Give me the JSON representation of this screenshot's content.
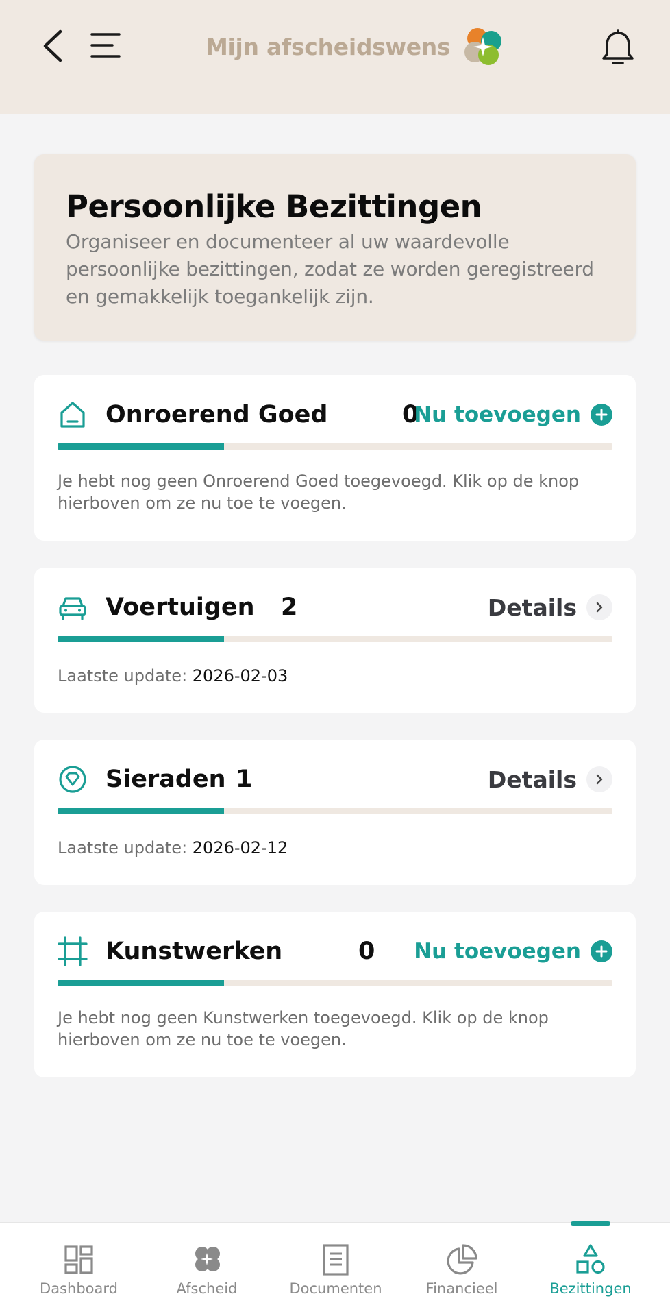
{
  "header": {
    "brand_title": "Mijn afscheidswens",
    "back_icon": "chevron-left-icon",
    "menu_icon": "hamburger-menu-icon",
    "bell_icon": "bell-icon"
  },
  "intro": {
    "title": "Persoonlijke Bezittingen",
    "description": "Organiseer en documenteer al uw waardevolle persoonlijke bezittingen, zodat ze worden geregistreerd en gemakkelijk toegankelijk zijn."
  },
  "cards": [
    {
      "icon": "house-icon",
      "title": "Onroerend Goed",
      "count": "0",
      "action_label": "Nu toevoegen",
      "progress": 0.3,
      "message": "Je hebt nog geen Onroerend Goed toegevoegd. Klik op de knop hierboven om ze nu toe te voegen."
    },
    {
      "icon": "car-icon",
      "title": "Voertuigen",
      "count": "2",
      "action_label": "Details",
      "progress": 0.3,
      "update_label": "Laatste update: ",
      "update_date": "2026-02-03"
    },
    {
      "icon": "gem-icon",
      "title": "Sieraden",
      "count": "1",
      "action_label": "Details",
      "progress": 0.3,
      "update_label": "Laatste update: ",
      "update_date": "2026-02-12"
    },
    {
      "icon": "frame-icon",
      "title": "Kunstwerken",
      "count": "0",
      "action_label": "Nu toevoegen",
      "progress": 0.3,
      "message": "Je hebt nog geen Kunstwerken toegevoegd. Klik op de knop hierboven om ze nu toe te voegen."
    }
  ],
  "bottom_nav": [
    {
      "label": "Dashboard",
      "icon": "dashboard-grid-icon",
      "active": false
    },
    {
      "label": "Afscheid",
      "icon": "clover-icon",
      "active": false
    },
    {
      "label": "Documenten",
      "icon": "document-icon",
      "active": false
    },
    {
      "label": "Financieel",
      "icon": "pie-chart-icon",
      "active": false
    },
    {
      "label": "Bezittingen",
      "icon": "shapes-icon",
      "active": true
    }
  ],
  "colors": {
    "accent": "#1a9e95",
    "header_bg": "#f0e9e2",
    "brand_text": "#bba994",
    "page_bg": "#f4f4f5"
  }
}
